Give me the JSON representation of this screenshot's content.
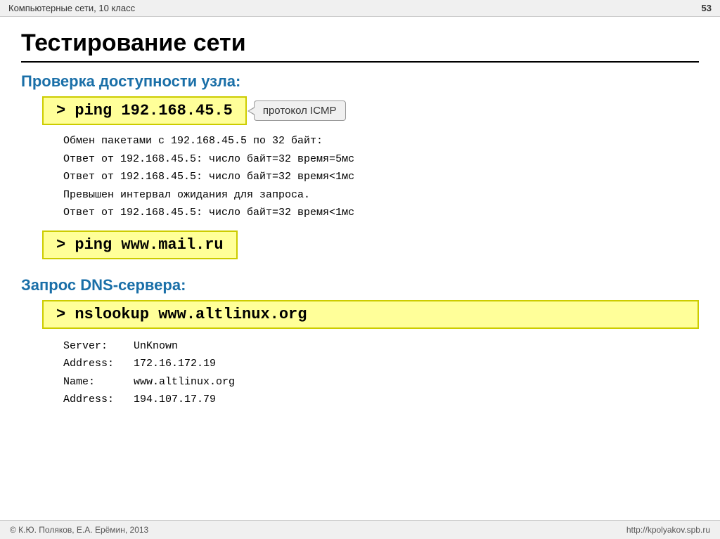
{
  "topbar": {
    "title": "Компьютерные сети, 10 класс",
    "slide_number": "53"
  },
  "page": {
    "title": "Тестирование сети"
  },
  "section1": {
    "heading": "Проверка доступности узла:",
    "command1": "> ping 192.168.45.5",
    "icmp_label": "протокол ICMP",
    "output": [
      "Обмен пакетами с 192.168.45.5 по 32 байт:",
      "Ответ от 192.168.45.5: число байт=32 время=5мс",
      "Ответ от 192.168.45.5: число байт=32 время<1мс",
      "Превышен интервал ожидания для запроса.",
      "Ответ от 192.168.45.5: число байт=32 время<1мс"
    ],
    "command2": "> ping www.mail.ru"
  },
  "section2": {
    "heading": "Запрос DNS-сервера:",
    "command": "> nslookup www.altlinux.org",
    "output_rows": [
      {
        "key": "Server:",
        "value": "UnKnown"
      },
      {
        "key": "Address:",
        "value": "172.16.172.19"
      },
      {
        "key": "Name:",
        "value": "www.altlinux.org"
      },
      {
        "key": "Address:",
        "value": "194.107.17.79"
      }
    ]
  },
  "footer": {
    "left": "© К.Ю. Поляков, Е.А. Ерёмин, 2013",
    "right": "http://kpolyakov.spb.ru"
  }
}
